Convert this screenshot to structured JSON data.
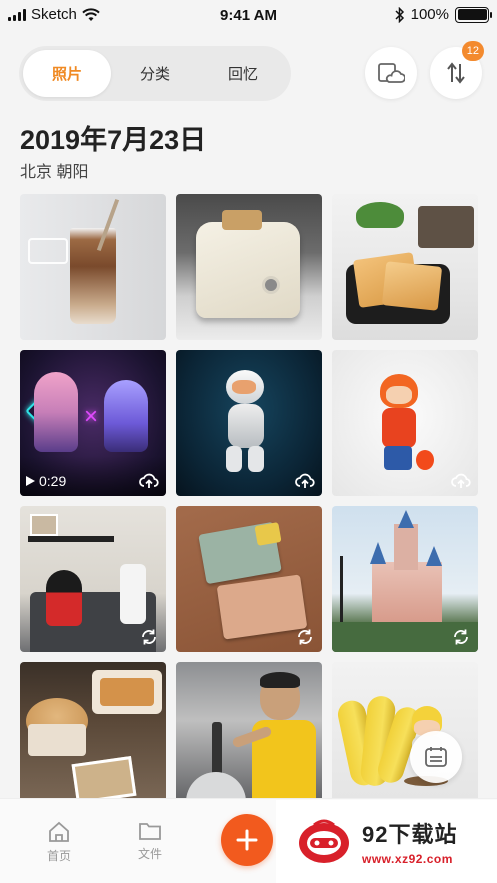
{
  "status_bar": {
    "carrier": "Sketch",
    "time": "9:41 AM",
    "battery": "100%"
  },
  "tabs": [
    {
      "label": "照片",
      "active": true
    },
    {
      "label": "分类",
      "active": false
    },
    {
      "label": "回忆",
      "active": false
    }
  ],
  "actions": {
    "cloud_icon": "cloud-device-icon",
    "sort_icon": "sort-arrows-icon",
    "sort_badge": "12"
  },
  "section": {
    "date": "2019年7月23日",
    "location": "北京 朝阳"
  },
  "photos": [
    {
      "name": "iced-coffee-photo",
      "badge": ""
    },
    {
      "name": "toaster-photo",
      "badge": ""
    },
    {
      "name": "toast-pan-photo",
      "badge": ""
    },
    {
      "name": "neon-figures-video",
      "badge": "upload",
      "duration": "0:29"
    },
    {
      "name": "astronaut-figure-photo",
      "badge": "upload"
    },
    {
      "name": "red-hoodie-figure-photo",
      "badge": "upload"
    },
    {
      "name": "mickey-shelf-photo",
      "badge": "sync"
    },
    {
      "name": "cards-photo",
      "badge": "sync"
    },
    {
      "name": "castle-photo",
      "badge": "sync"
    },
    {
      "name": "souffle-table-photo",
      "badge": ""
    },
    {
      "name": "cooking-man-photo",
      "badge": ""
    },
    {
      "name": "banana-figure-photo",
      "badge": ""
    }
  ],
  "bottom_nav": {
    "home": "首页",
    "files": "文件"
  },
  "watermark": {
    "title": "92下载站",
    "url": "www.xz92.com"
  },
  "colors": {
    "accent": "#f08a24",
    "add_button": "#f25a1e",
    "badge": "#f38a2e"
  }
}
